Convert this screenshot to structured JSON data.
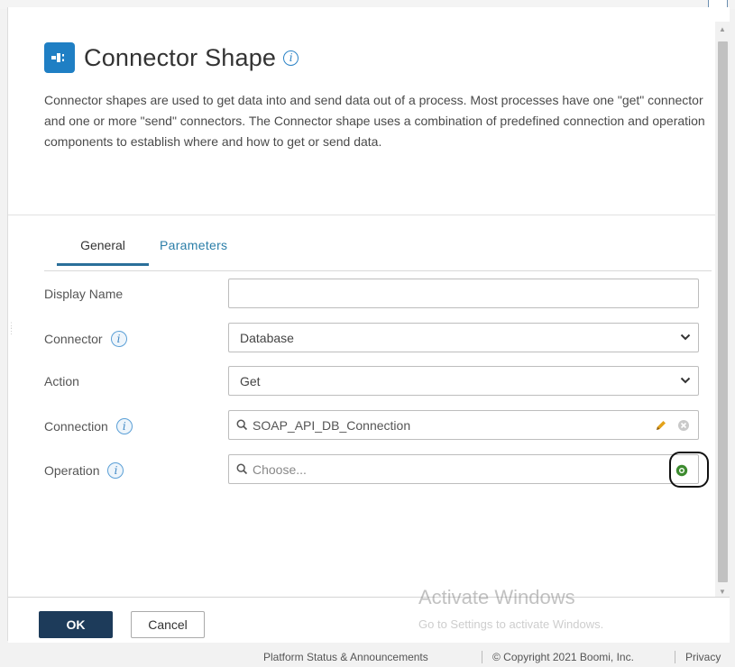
{
  "dialog": {
    "title": "Connector Shape",
    "info_glyph": "i",
    "description": "Connector shapes are used to get data into and send data out of a process. Most processes have one \"get\" connector and one or more \"send\" connectors. The Connector shape uses a combination of predefined connection and operation components to establish where and how to get or send data.",
    "icon": "connector-shape-icon",
    "accent_color": "#1f7fc4"
  },
  "tabs": [
    {
      "label": "General",
      "active": true
    },
    {
      "label": "Parameters",
      "active": false
    }
  ],
  "form": {
    "display_name": {
      "label": "Display Name",
      "value": "",
      "placeholder": ""
    },
    "connector": {
      "label": "Connector",
      "value": "Database"
    },
    "action": {
      "label": "Action",
      "value": "Get"
    },
    "connection": {
      "label": "Connection",
      "value": "SOAP_API_DB_Connection"
    },
    "operation": {
      "label": "Operation",
      "placeholder": "Choose..."
    }
  },
  "footer": {
    "ok_label": "OK",
    "cancel_label": "Cancel",
    "ok_color": "#1d3b5a"
  },
  "watermark": {
    "title": "Activate Windows",
    "subtitle": "Go to Settings to activate Windows."
  },
  "statusbar": {
    "status_link": "Platform Status & Announcements",
    "copyright": "© Copyright 2021 Boomi, Inc.",
    "privacy_link": "Privacy"
  }
}
